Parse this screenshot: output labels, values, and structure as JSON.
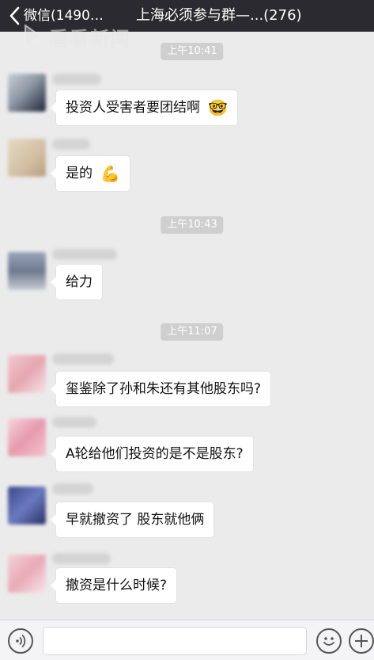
{
  "header": {
    "back_label": "微信(1490…",
    "title": "上海必须参与群—...(276)"
  },
  "watermark": {
    "text": "看看新闻"
  },
  "timestamps": [
    "上午10:41",
    "上午10:43",
    "上午11:07"
  ],
  "messages": [
    {
      "text": "投资人受害者要团结啊",
      "emoji": "🤓"
    },
    {
      "text": "是的",
      "emoji": "💪"
    },
    {
      "text": "给力"
    },
    {
      "text": "玺鉴除了孙和朱还有其他股东吗?"
    },
    {
      "text": "A轮给他们投资的是不是股东?"
    },
    {
      "text": "早就撤资了   股东就他俩"
    },
    {
      "text": "撤资是什么时候?"
    }
  ],
  "colors": {
    "header_bg": "#2b2a30",
    "chat_bg": "#ebebeb",
    "bubble_bg": "#ffffff",
    "timestamp_bg": "#cfcfcf"
  },
  "icons": {
    "back": "chevron-left-icon",
    "voice": "voice-icon",
    "emoji": "emoji-icon",
    "plus": "plus-icon"
  }
}
